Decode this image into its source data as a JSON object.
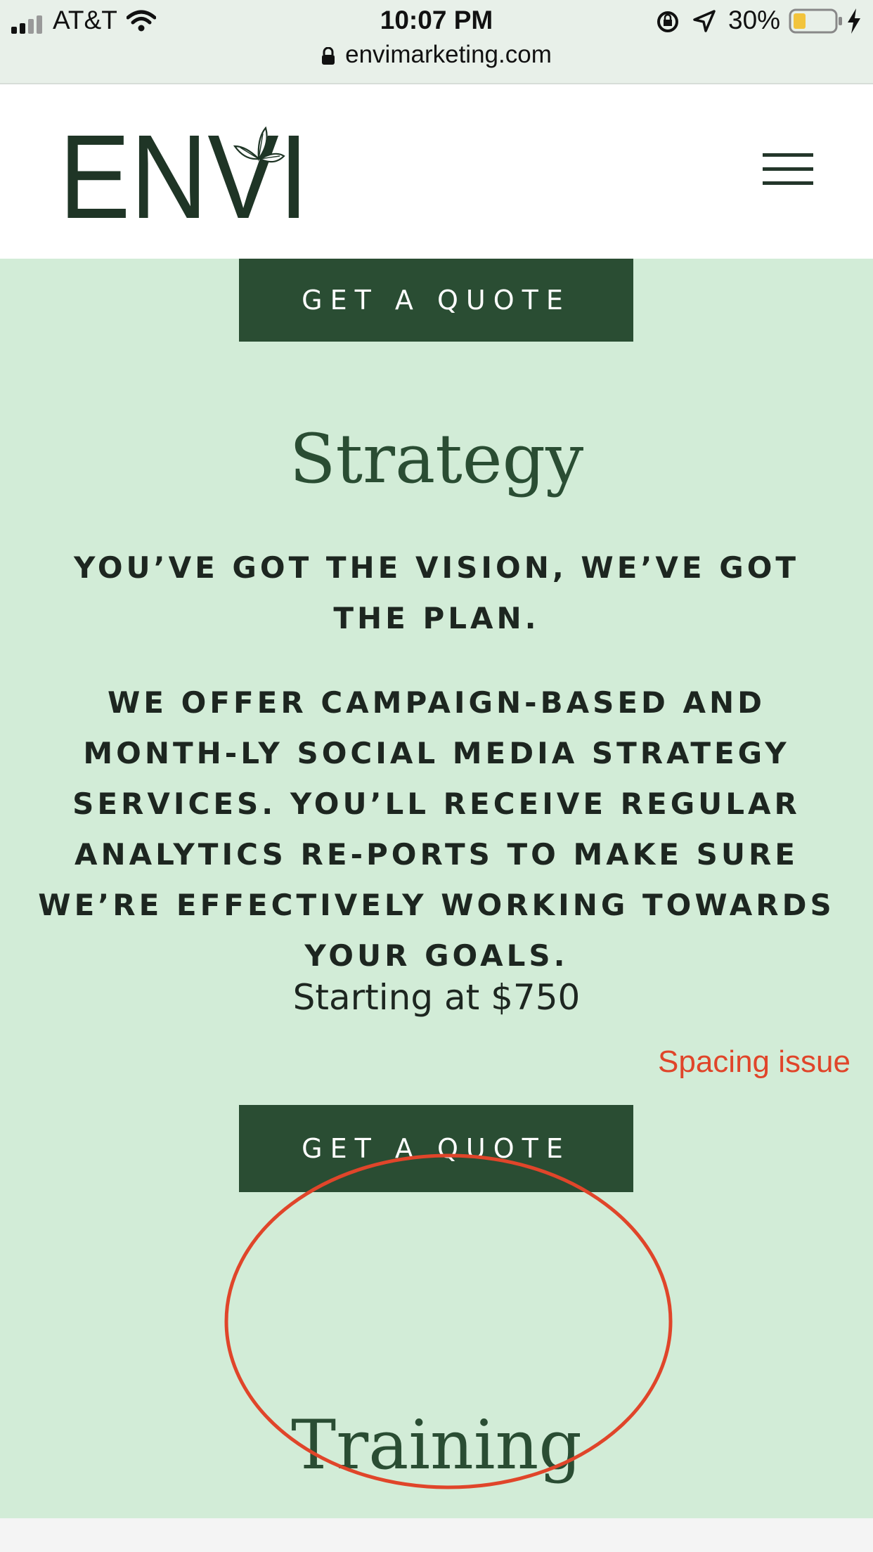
{
  "status_bar": {
    "carrier": "AT&T",
    "time": "10:07 PM",
    "battery_percent": "30%",
    "url": "envimarketing.com",
    "battery_color": "#f2c43d"
  },
  "header": {
    "logo_text": "ENVI"
  },
  "content": {
    "quote_button_label": "GET A QUOTE",
    "strategy_title": "Strategy",
    "tagline": "YOU’VE GOT THE VISION, WE’VE GOT THE PLAN.",
    "description": "WE OFFER CAMPAIGN-BASED AND MONTH-LY SOCIAL MEDIA STRATEGY SERVICES. YOU’LL RECEIVE REGULAR ANALYTICS RE-PORTS TO MAKE SURE WE’RE EFFECTIVELY WORKING TOWARDS YOUR GOALS.",
    "price": "Starting at $750",
    "training_title": "Training"
  },
  "annotation": {
    "label": "Spacing issue",
    "color": "#e0452a"
  },
  "colors": {
    "brand_dark_green": "#2a4d33",
    "section_background": "#d2ecd7"
  }
}
